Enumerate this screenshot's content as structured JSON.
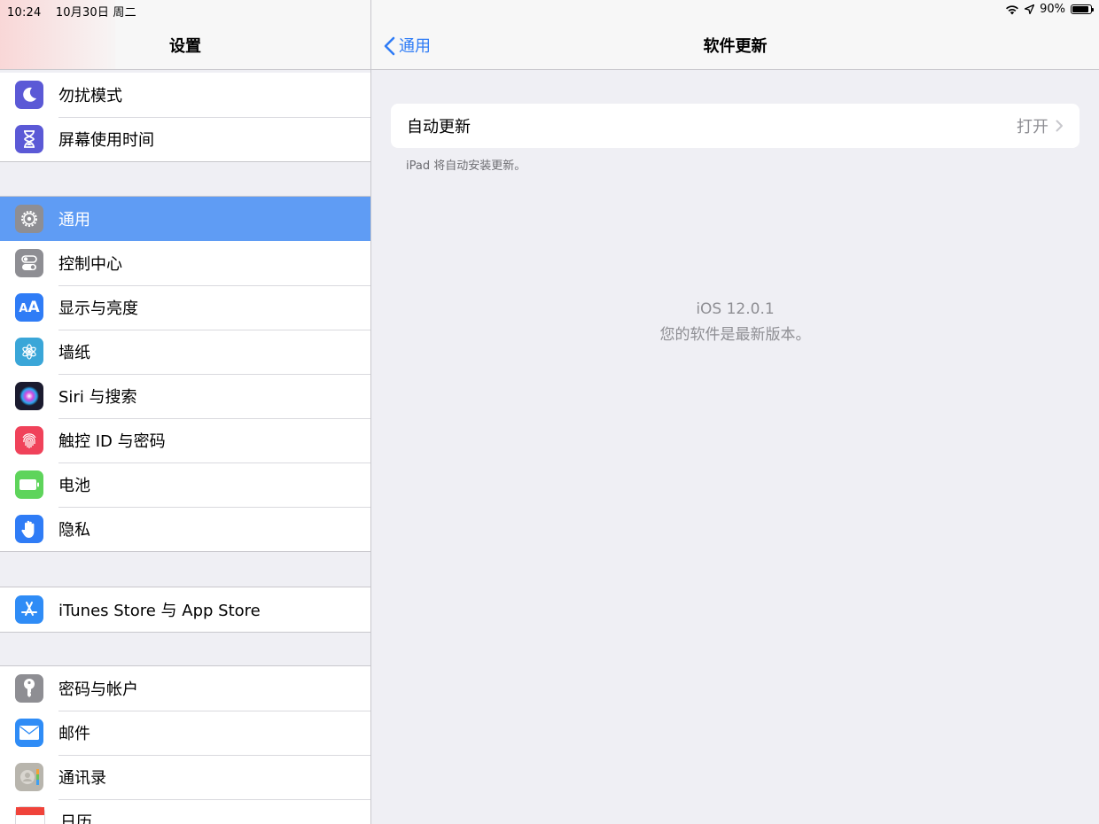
{
  "status": {
    "time": "10:24",
    "date": "10月30日 周二",
    "battery": "90%",
    "battery_level": 0.9
  },
  "sidebar": {
    "title": "设置",
    "groups": [
      [
        {
          "label": "勿扰模式",
          "icon": "moon-icon",
          "color": "#5b59d6"
        },
        {
          "label": "屏幕使用时间",
          "icon": "hourglass-icon",
          "color": "#5b59d6"
        }
      ],
      [
        {
          "label": "通用",
          "icon": "gear-icon",
          "color": "#8e8e93",
          "selected": true
        },
        {
          "label": "控制中心",
          "icon": "switches-icon",
          "color": "#8e8e93"
        },
        {
          "label": "显示与亮度",
          "icon": "text-size-icon",
          "color": "#2f7cf6"
        },
        {
          "label": "墙纸",
          "icon": "flower-icon",
          "color": "#3aa6d8"
        },
        {
          "label": "Siri 与搜索",
          "icon": "siri-icon",
          "color": "#1b1b2f"
        },
        {
          "label": "触控 ID 与密码",
          "icon": "fingerprint-icon",
          "color": "#f0425a"
        },
        {
          "label": "电池",
          "icon": "battery-icon",
          "color": "#5ed45b"
        },
        {
          "label": "隐私",
          "icon": "hand-icon",
          "color": "#2f7cf6"
        }
      ],
      [
        {
          "label": "iTunes Store 与 App Store",
          "icon": "appstore-icon",
          "color": "#2f8cf6"
        }
      ],
      [
        {
          "label": "密码与帐户",
          "icon": "key-icon",
          "color": "#8e8e93"
        },
        {
          "label": "邮件",
          "icon": "envelope-icon",
          "color": "#2f8cf6"
        },
        {
          "label": "通讯录",
          "icon": "contacts-icon",
          "color": "#b8b5ad"
        },
        {
          "label": "日历",
          "icon": "calendar-icon",
          "color": "#ffffff"
        }
      ]
    ]
  },
  "detail": {
    "back_label": "通用",
    "title": "软件更新",
    "auto_update": {
      "label": "自动更新",
      "value": "打开"
    },
    "note": "iPad 将自动安装更新。",
    "version": "iOS 12.0.1",
    "version_status": "您的软件是最新版本。"
  }
}
